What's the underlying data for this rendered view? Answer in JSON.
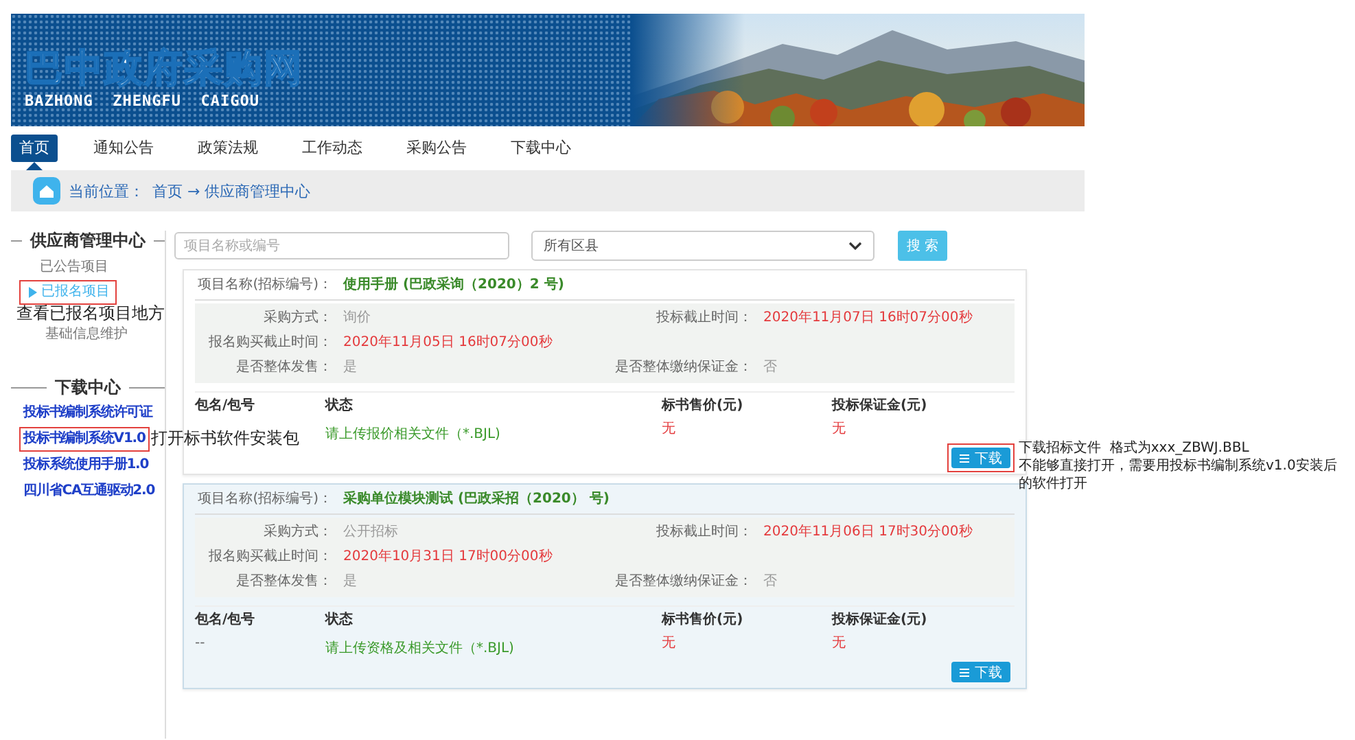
{
  "header": {
    "title": "巴中政府采购网",
    "subtitle": "BAZHONG  ZHENGFU  CAIGOU"
  },
  "nav": [
    {
      "label": "首页",
      "selected": true
    },
    {
      "label": "通知公告",
      "selected": false
    },
    {
      "label": "政策法规",
      "selected": false
    },
    {
      "label": "工作动态",
      "selected": false
    },
    {
      "label": "采购公告",
      "selected": false
    },
    {
      "label": "下载中心",
      "selected": false
    }
  ],
  "breadcrumb": {
    "label": "当前位置：",
    "path": "首页 → 供应商管理中心"
  },
  "sidebar": {
    "manage": {
      "title": "供应商管理中心",
      "items": [
        {
          "label": "已公告项目",
          "selected": false,
          "highlighted": false
        },
        {
          "label": "已报名项目",
          "selected": true,
          "highlighted": true,
          "annotation": "查看已报名项目地方"
        },
        {
          "label": "基础信息维护",
          "selected": false,
          "highlighted": false
        }
      ]
    },
    "downloads": {
      "title": "下载中心",
      "links": [
        {
          "label": "投标书编制系统许可证",
          "highlighted": false
        },
        {
          "label": "投标书编制系统V1.0",
          "highlighted": true,
          "annotation": "打开标书软件安装包"
        },
        {
          "label": "投标系统使用手册1.0",
          "highlighted": false
        },
        {
          "label": "四川省CA互通驱动2.0",
          "highlighted": false
        }
      ]
    }
  },
  "search": {
    "placeholder": "项目名称或编号",
    "region": "所有区县",
    "button": "搜 索"
  },
  "projects": [
    {
      "name_label": "项目名称(招标编号)：",
      "name": "使用手册 (巴政采询（2020）2 号)",
      "hovered": false,
      "detail_rows": [
        {
          "cells": [
            {
              "label": "采购方式：",
              "value": "询价",
              "kind": "plain"
            },
            {
              "label": "投标截止时间：",
              "value": "2020年11月07日 16时07分00秒",
              "kind": "deadline"
            }
          ]
        },
        {
          "cells": [
            {
              "label": "报名购买截止时间：",
              "value": "2020年11月05日 16时07分00秒",
              "kind": "deadline"
            }
          ]
        },
        {
          "cells": [
            {
              "label": "是否整体发售：",
              "value": "是",
              "kind": "plain"
            },
            {
              "label": "是否整体缴纳保证金：",
              "value": "否",
              "kind": "plain"
            }
          ]
        }
      ],
      "columns": [
        "包名/包号",
        "状态",
        "标书售价(元)",
        "投标保证金(元)"
      ],
      "packages": [
        {
          "status": "请上传报价相关文件（*.BJL)",
          "price": "无",
          "deposit": "无"
        }
      ],
      "download": {
        "label": "下载",
        "highlighted": true,
        "annotation": [
          "下载招标文件  格式为xxx_ZBWJ.BBL",
          "不能够直接打开，需要用投标书编制系统v1.0安装后的软件打开"
        ]
      }
    },
    {
      "name_label": "项目名称(招标编号)：",
      "name": "采购单位模块测试 (巴政采招（2020） 号)",
      "hovered": true,
      "detail_rows": [
        {
          "cells": [
            {
              "label": "采购方式：",
              "value": "公开招标",
              "kind": "plain"
            },
            {
              "label": "投标截止时间：",
              "value": "2020年11月06日 17时30分00秒",
              "kind": "deadline"
            }
          ]
        },
        {
          "cells": [
            {
              "label": "报名购买截止时间：",
              "value": "2020年10月31日 17时00分00秒",
              "kind": "deadline"
            }
          ]
        },
        {
          "cells": [
            {
              "label": "是否整体发售：",
              "value": "是",
              "kind": "plain"
            },
            {
              "label": "是否整体缴纳保证金：",
              "value": "否",
              "kind": "plain"
            }
          ]
        }
      ],
      "columns": [
        "包名/包号",
        "状态",
        "标书售价(元)",
        "投标保证金(元)"
      ],
      "packages": [
        {
          "name": "--",
          "status": "请上传资格及相关文件（*.BJL)",
          "price": "无",
          "deposit": "无"
        }
      ],
      "download": {
        "label": "下载",
        "highlighted": false
      }
    }
  ]
}
